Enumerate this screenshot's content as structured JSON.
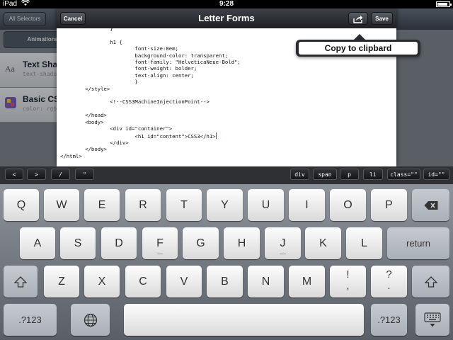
{
  "status_bar": {
    "device": "iPad",
    "time": "9:28",
    "battery_level": 0.9
  },
  "background_app": {
    "selectors_button": "All Selectors",
    "segment_label": "Animations",
    "rows": [
      {
        "title": "Text Shadow",
        "subtitle": "text-shadow:"
      },
      {
        "title": "Basic CSS",
        "subtitle": "color: rgba"
      }
    ]
  },
  "editor": {
    "title": "Letter Forms",
    "cancel_label": "Cancel",
    "save_label": "Save",
    "code": "                }\n\n                h1 {\n                        font-size:8em;\n                        background-color: transparent;\n                        font-family: \"HelveticaNeue-Bold\";\n                        font-weight: bolder;\n                        text-align: center;\n                        }\n        </style>\n\n                <!--CSS3MachineInjectionPoint-->\n\n        </head>\n        <body>\n                <div id=\"container\">\n                        <h1 id=\"content\">CSS3</h1>",
    "code_tail": "                </div>\n        </body>\n</html>"
  },
  "popover": {
    "copy_label": "Copy to clipbard"
  },
  "accessory_bar": {
    "left_keys": [
      "<",
      ">",
      "/",
      "\""
    ],
    "right_keys": [
      "div",
      "span",
      "p",
      "li",
      "class=\"\"",
      "id=\"\""
    ]
  },
  "keyboard": {
    "row1": [
      "Q",
      "W",
      "E",
      "R",
      "T",
      "Y",
      "U",
      "I",
      "O",
      "P"
    ],
    "row2": [
      "A",
      "S",
      "D",
      "F",
      "G",
      "H",
      "J",
      "K",
      "L"
    ],
    "row3": [
      "Z",
      "X",
      "C",
      "V",
      "B",
      "N",
      "M"
    ],
    "return_label": "return",
    "exclaim_top": "!",
    "exclaim_bottom": ",",
    "question_top": "?",
    "question_bottom": ".",
    "numbers_label": ".?123",
    "numbers_label_right": ".?123"
  }
}
